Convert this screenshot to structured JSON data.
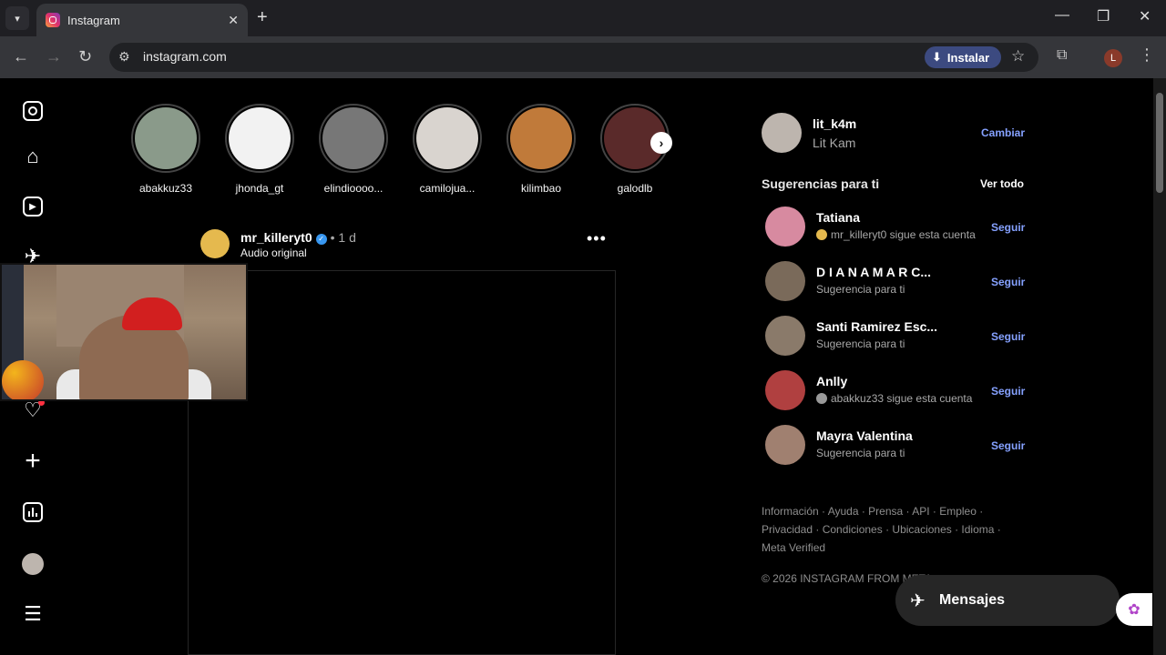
{
  "browser": {
    "tab_title": "Instagram",
    "url": "instagram.com",
    "install_label": "Instalar",
    "profile_initial": "L"
  },
  "stories": [
    {
      "username": "abakkuz33",
      "color": "#8a9a8a"
    },
    {
      "username": "jhonda_gt",
      "color": "#f2f2f2"
    },
    {
      "username": "elindioooo...",
      "color": "#777777"
    },
    {
      "username": "camilojua...",
      "color": "#d9d4cf"
    },
    {
      "username": "kilimbao",
      "color": "#c07a3a"
    },
    {
      "username": "galodlb",
      "color": "#5a2a2a"
    }
  ],
  "post": {
    "username": "mr_killeryt0",
    "time": "• 1 d",
    "subtitle": "Audio original"
  },
  "current_user": {
    "username": "lit_k4m",
    "name": "Lit Kam",
    "switch_label": "Cambiar"
  },
  "suggestions": {
    "title": "Sugerencias para ti",
    "see_all": "Ver todo",
    "follow_label": "Seguir",
    "items": [
      {
        "name": "Tatiana",
        "subtitle": "mr_killeryt0 sigue esta cuenta",
        "color": "#d78aa0"
      },
      {
        "name": "D I A N A M A R C...",
        "subtitle": "Sugerencia para ti",
        "color": "#7a6a5a"
      },
      {
        "name": "Santi Ramirez Esc...",
        "subtitle": "Sugerencia para ti",
        "color": "#8a7a6a"
      },
      {
        "name": "Anlly",
        "subtitle": "abakkuz33 sigue esta cuenta",
        "color": "#b04040"
      },
      {
        "name": "Mayra Valentina",
        "subtitle": "Sugerencia para ti",
        "color": "#a08070"
      }
    ]
  },
  "footer": {
    "links": "Información · Ayuda · Prensa · API · Empleo · Privacidad · Condiciones · Ubicaciones · Idioma · Meta Verified",
    "copyright": "© 2026 INSTAGRAM FROM META"
  },
  "messages": {
    "label": "Mensajes"
  }
}
